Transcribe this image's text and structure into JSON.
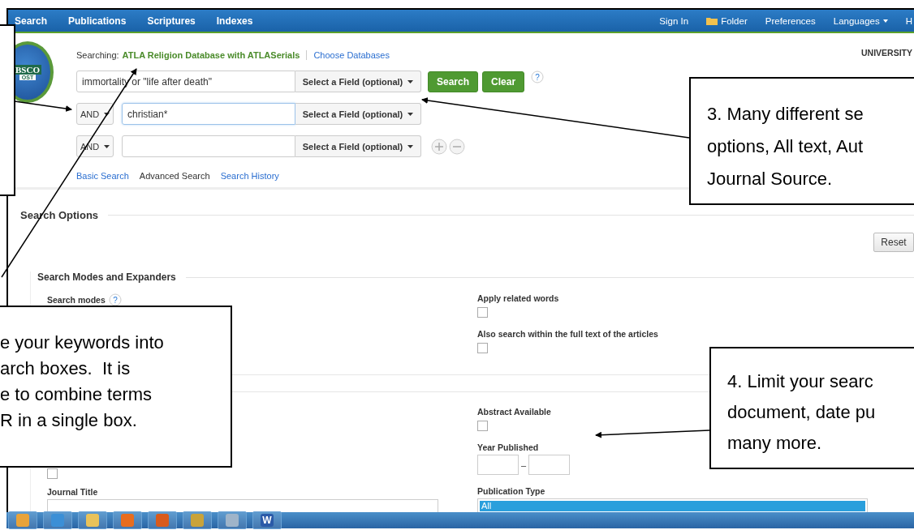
{
  "nav": {
    "left": [
      "Search",
      "Publications",
      "Scriptures",
      "Indexes"
    ],
    "right": [
      {
        "label": "Sign In",
        "kind": "link"
      },
      {
        "label": "Folder",
        "kind": "folder"
      },
      {
        "label": "Preferences",
        "kind": "link"
      },
      {
        "label": "Languages",
        "kind": "dropdown"
      },
      {
        "label": "H",
        "kind": "link"
      }
    ]
  },
  "logo": {
    "line1": "BSCO",
    "line2": "OST"
  },
  "org": "UNIVERSITY",
  "searching": {
    "label": "Searching:",
    "database": "ATLA Religion Database with ATLASerials",
    "link": "Choose Databases"
  },
  "rows": [
    {
      "value": "immortality or \"life after death\"",
      "field": "Select a Field (optional)",
      "focused": false
    },
    {
      "operator": "AND",
      "value": "christian*",
      "field": "Select a Field (optional)",
      "focused": true
    },
    {
      "operator": "AND",
      "field": "Select a Field (optional)",
      "focused": false
    }
  ],
  "buttons": [
    "Search",
    "Clear"
  ],
  "help_marks": [
    "?",
    "?"
  ],
  "links": [
    {
      "label": "Basic Search",
      "selected": false
    },
    {
      "label": "Advanced Search",
      "selected": true
    },
    {
      "label": "Search History",
      "selected": false
    }
  ],
  "options": {
    "title": "Search Options",
    "reset": "Reset",
    "modes_title": "Search Modes and Expanders",
    "search_modes": "Search modes",
    "apply_related": {
      "label": "Apply related words",
      "checked": false
    },
    "full_text": {
      "label": "Also search within the full text of the articles",
      "checked": false
    }
  },
  "limiters": {
    "left_checkbox": {
      "checked": false
    },
    "journal_title": "Journal Title",
    "abstract": {
      "label": "Abstract Available",
      "checked": false
    },
    "year": "Year Published",
    "dash": "–",
    "pub_type": {
      "label": "Publication Type",
      "options": [
        {
          "label": "All",
          "selected": true
        }
      ]
    }
  },
  "taskbar": [
    {
      "kind": "outlook"
    },
    {
      "kind": "browser"
    },
    {
      "kind": "folder"
    },
    {
      "kind": "media"
    },
    {
      "kind": "firefox"
    },
    {
      "kind": "disc"
    },
    {
      "kind": "notes"
    },
    {
      "kind": "word",
      "glyph": "W"
    }
  ],
  "callouts": [
    {
      "lines": [
        "e your keywords into",
        "arch boxes.  It is",
        "e to combine terms",
        "R in a single box."
      ]
    },
    {
      "lines": [
        "3. Many different se",
        "options, All text, Aut",
        "Journal Source."
      ]
    },
    {
      "lines": [
        "4. Limit your searc",
        "document, date pu",
        "many more."
      ]
    }
  ]
}
